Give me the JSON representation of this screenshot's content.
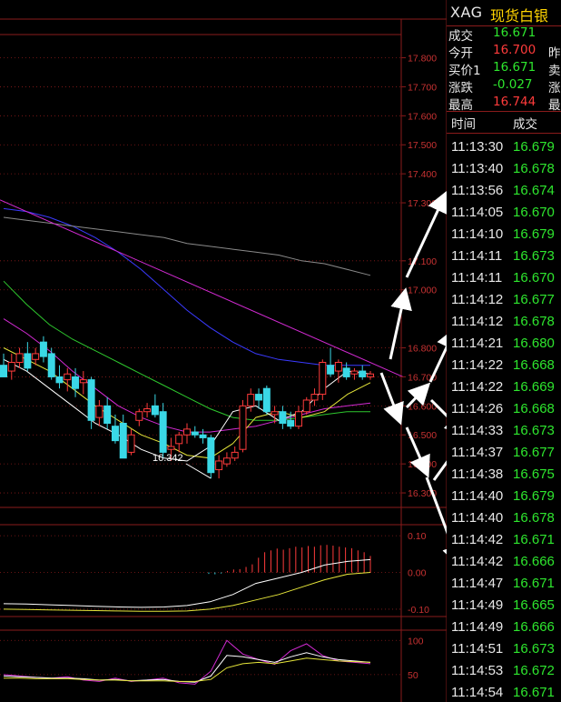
{
  "quote": {
    "symbol": "XAG",
    "name": "现货白银",
    "rows": [
      {
        "label": "成交",
        "value": "16.671",
        "color": "#2ee62e",
        "label2": ""
      },
      {
        "label": "今开",
        "value": "16.700",
        "color": "#ff3b3b",
        "label2": "昨"
      },
      {
        "label": "买价1",
        "value": "16.671",
        "color": "#2ee62e",
        "label2": "卖"
      },
      {
        "label": "涨跌",
        "value": "-0.027",
        "color": "#2ee62e",
        "label2": "涨"
      },
      {
        "label": "最高",
        "value": "16.744",
        "color": "#ff3b3b",
        "label2": "最"
      }
    ]
  },
  "trades": {
    "col_time": "时间",
    "col_price": "成交",
    "rows": [
      {
        "time": "11:13:30",
        "price": "16.679"
      },
      {
        "time": "11:13:40",
        "price": "16.678"
      },
      {
        "time": "11:13:56",
        "price": "16.674"
      },
      {
        "time": "11:14:05",
        "price": "16.670"
      },
      {
        "time": "11:14:10",
        "price": "16.679"
      },
      {
        "time": "11:14:11",
        "price": "16.673"
      },
      {
        "time": "11:14:11",
        "price": "16.670"
      },
      {
        "time": "11:14:12",
        "price": "16.677"
      },
      {
        "time": "11:14:12",
        "price": "16.678"
      },
      {
        "time": "11:14:21",
        "price": "16.680"
      },
      {
        "time": "11:14:22",
        "price": "16.668"
      },
      {
        "time": "11:14:22",
        "price": "16.669"
      },
      {
        "time": "11:14:26",
        "price": "16.668"
      },
      {
        "time": "11:14:33",
        "price": "16.673"
      },
      {
        "time": "11:14:37",
        "price": "16.677"
      },
      {
        "time": "11:14:38",
        "price": "16.675"
      },
      {
        "time": "11:14:40",
        "price": "16.679"
      },
      {
        "time": "11:14:40",
        "price": "16.678"
      },
      {
        "time": "11:14:42",
        "price": "16.671"
      },
      {
        "time": "11:14:42",
        "price": "16.666"
      },
      {
        "time": "11:14:47",
        "price": "16.671"
      },
      {
        "time": "11:14:49",
        "price": "16.665"
      },
      {
        "time": "11:14:49",
        "price": "16.666"
      },
      {
        "time": "11:14:51",
        "price": "16.673"
      },
      {
        "time": "11:14:53",
        "price": "16.672"
      },
      {
        "time": "11:14:54",
        "price": "16.671"
      }
    ]
  },
  "chart_data": [
    {
      "type": "candlestick",
      "title": "",
      "ylim": [
        16.25,
        17.88
      ],
      "y_ticks": [
        "17.800",
        "17.700",
        "17.600",
        "17.500",
        "17.400",
        "17.300",
        "17.100",
        "17.000",
        "16.800",
        "16.700",
        "16.600",
        "16.500",
        "16.400",
        "16.300"
      ],
      "annotations": [
        "16.342"
      ],
      "candles": [
        {
          "o": 16.74,
          "h": 16.78,
          "l": 16.7,
          "c": 16.7
        },
        {
          "o": 16.72,
          "h": 16.78,
          "l": 16.69,
          "c": 16.75
        },
        {
          "o": 16.75,
          "h": 16.8,
          "l": 16.73,
          "c": 16.78
        },
        {
          "o": 16.78,
          "h": 16.82,
          "l": 16.72,
          "c": 16.73
        },
        {
          "o": 16.76,
          "h": 16.8,
          "l": 16.74,
          "c": 16.78
        },
        {
          "o": 16.82,
          "h": 16.84,
          "l": 16.75,
          "c": 16.77
        },
        {
          "o": 16.78,
          "h": 16.8,
          "l": 16.69,
          "c": 16.7
        },
        {
          "o": 16.7,
          "h": 16.74,
          "l": 16.66,
          "c": 16.68
        },
        {
          "o": 16.69,
          "h": 16.73,
          "l": 16.65,
          "c": 16.71
        },
        {
          "o": 16.7,
          "h": 16.73,
          "l": 16.63,
          "c": 16.66
        },
        {
          "o": 16.68,
          "h": 16.72,
          "l": 16.64,
          "c": 16.69
        },
        {
          "o": 16.69,
          "h": 16.7,
          "l": 16.52,
          "c": 16.55
        },
        {
          "o": 16.56,
          "h": 16.62,
          "l": 16.53,
          "c": 16.6
        },
        {
          "o": 16.6,
          "h": 16.63,
          "l": 16.52,
          "c": 16.54
        },
        {
          "o": 16.53,
          "h": 16.57,
          "l": 16.47,
          "c": 16.48
        },
        {
          "o": 16.54,
          "h": 16.57,
          "l": 16.42,
          "c": 16.42
        },
        {
          "o": 16.44,
          "h": 16.52,
          "l": 16.43,
          "c": 16.5
        },
        {
          "o": 16.55,
          "h": 16.59,
          "l": 16.53,
          "c": 16.58
        },
        {
          "o": 16.58,
          "h": 16.61,
          "l": 16.56,
          "c": 16.59
        },
        {
          "o": 16.6,
          "h": 16.64,
          "l": 16.56,
          "c": 16.57
        },
        {
          "o": 16.58,
          "h": 16.61,
          "l": 16.42,
          "c": 16.44
        },
        {
          "o": 16.45,
          "h": 16.49,
          "l": 16.41,
          "c": 16.46
        },
        {
          "o": 16.47,
          "h": 16.51,
          "l": 16.44,
          "c": 16.5
        },
        {
          "o": 16.5,
          "h": 16.54,
          "l": 16.47,
          "c": 16.52
        },
        {
          "o": 16.51,
          "h": 16.53,
          "l": 16.49,
          "c": 16.5
        },
        {
          "o": 16.5,
          "h": 16.52,
          "l": 16.47,
          "c": 16.49
        },
        {
          "o": 16.49,
          "h": 16.5,
          "l": 16.35,
          "c": 16.37
        },
        {
          "o": 16.38,
          "h": 16.43,
          "l": 16.35,
          "c": 16.41
        },
        {
          "o": 16.4,
          "h": 16.44,
          "l": 16.39,
          "c": 16.42
        },
        {
          "o": 16.42,
          "h": 16.46,
          "l": 16.41,
          "c": 16.44
        },
        {
          "o": 16.45,
          "h": 16.62,
          "l": 16.44,
          "c": 16.6
        },
        {
          "o": 16.6,
          "h": 16.66,
          "l": 16.58,
          "c": 16.64
        },
        {
          "o": 16.64,
          "h": 16.66,
          "l": 16.59,
          "c": 16.62
        },
        {
          "o": 16.66,
          "h": 16.67,
          "l": 16.57,
          "c": 16.58
        },
        {
          "o": 16.57,
          "h": 16.6,
          "l": 16.54,
          "c": 16.58
        },
        {
          "o": 16.58,
          "h": 16.6,
          "l": 16.52,
          "c": 16.54
        },
        {
          "o": 16.55,
          "h": 16.58,
          "l": 16.52,
          "c": 16.53
        },
        {
          "o": 16.53,
          "h": 16.6,
          "l": 16.52,
          "c": 16.58
        },
        {
          "o": 16.58,
          "h": 16.63,
          "l": 16.57,
          "c": 16.62
        },
        {
          "o": 16.62,
          "h": 16.66,
          "l": 16.6,
          "c": 16.64
        },
        {
          "o": 16.64,
          "h": 16.76,
          "l": 16.62,
          "c": 16.75
        },
        {
          "o": 16.74,
          "h": 16.8,
          "l": 16.7,
          "c": 16.71
        },
        {
          "o": 16.72,
          "h": 16.76,
          "l": 16.68,
          "c": 16.75
        },
        {
          "o": 16.73,
          "h": 16.75,
          "l": 16.69,
          "c": 16.7
        },
        {
          "o": 16.71,
          "h": 16.73,
          "l": 16.69,
          "c": 16.72
        },
        {
          "o": 16.72,
          "h": 16.74,
          "l": 16.69,
          "c": 16.7
        },
        {
          "o": 16.7,
          "h": 16.72,
          "l": 16.69,
          "c": 16.71
        }
      ],
      "moving_averages": [
        {
          "color": "#3a3aff",
          "values": [
            17.28,
            17.27,
            17.25,
            17.22,
            17.18,
            17.13,
            17.07,
            17.0,
            16.93,
            16.87,
            16.82,
            16.78,
            16.76,
            16.75,
            16.74,
            16.74,
            16.74
          ]
        },
        {
          "color": "#d22ad2",
          "values": [
            16.9,
            16.85,
            16.79,
            16.72,
            16.66,
            16.6,
            16.56,
            16.53,
            16.51,
            16.51,
            16.52,
            16.53,
            16.55,
            16.57,
            16.59,
            16.6,
            16.61
          ]
        },
        {
          "color": "#2ec82e",
          "values": [
            17.03,
            16.95,
            16.88,
            16.83,
            16.79,
            16.75,
            16.71,
            16.67,
            16.63,
            16.59,
            16.56,
            16.55,
            16.55,
            16.56,
            16.57,
            16.58,
            16.58
          ]
        },
        {
          "color": "#8a8a8a",
          "values": [
            17.25,
            17.24,
            17.23,
            17.22,
            17.21,
            17.2,
            17.19,
            17.18,
            17.16,
            17.15,
            17.14,
            17.13,
            17.12,
            17.1,
            17.09,
            17.07,
            17.05
          ]
        },
        {
          "color": "#e6e63a",
          "values": [
            16.8,
            16.76,
            16.72,
            16.66,
            16.6,
            16.55,
            16.5,
            16.47,
            16.43,
            16.42,
            16.47,
            16.56,
            16.58,
            16.56,
            16.58,
            16.64,
            16.68
          ]
        },
        {
          "color": "#ffffff",
          "values": [
            16.76,
            16.72,
            16.66,
            16.6,
            16.54,
            16.5,
            16.45,
            16.42,
            16.41,
            16.46,
            16.58,
            16.6,
            16.55,
            16.58,
            16.66,
            16.72,
            16.71
          ]
        }
      ],
      "trendline": {
        "color": "#d22ad2",
        "from": 17.31,
        "to": 16.7
      }
    },
    {
      "type": "bar",
      "title": "",
      "ylim": [
        -0.12,
        0.13
      ],
      "y_ticks": [
        "0.10",
        "0.00",
        "-0.10"
      ],
      "values": [
        0.0,
        0.0,
        0.0,
        0.0,
        0.0,
        0.0,
        0.0,
        0.0,
        0.0,
        0.0,
        0.0,
        0.0,
        0.0,
        0.0,
        0.0,
        0.0,
        0.0,
        0.0,
        0.0,
        0.0,
        0.0,
        0.0,
        0.0,
        0.0,
        0.0,
        0.0,
        0.0,
        0.0,
        0.0,
        0.0,
        0.0,
        0.0,
        0.0,
        -0.004,
        -0.005,
        -0.003,
        0.004,
        0.008,
        0.009,
        0.015,
        0.022,
        0.04,
        0.055,
        0.06,
        0.065,
        0.062,
        0.066,
        0.07,
        0.068,
        0.072,
        0.07,
        0.074,
        0.075,
        0.073,
        0.07,
        0.068,
        0.066,
        0.06,
        0.055,
        0.045
      ],
      "series": [
        {
          "color": "#ffffff",
          "values": [
            -0.085,
            -0.086,
            -0.088,
            -0.09,
            -0.092,
            -0.094,
            -0.095,
            -0.094,
            -0.09,
            -0.08,
            -0.06,
            -0.03,
            -0.015,
            0.0,
            0.02,
            0.03,
            0.035
          ]
        },
        {
          "color": "#e6e63a",
          "values": [
            -0.1,
            -0.101,
            -0.102,
            -0.103,
            -0.104,
            -0.105,
            -0.106,
            -0.106,
            -0.105,
            -0.1,
            -0.09,
            -0.075,
            -0.06,
            -0.04,
            -0.02,
            -0.005,
            0.0
          ]
        }
      ]
    },
    {
      "type": "line",
      "title": "",
      "ylim": [
        10,
        115
      ],
      "y_ticks": [
        "100",
        "50"
      ],
      "series": [
        {
          "color": "#d22ad2",
          "values": [
            50,
            48,
            46,
            45,
            47,
            42,
            40,
            45,
            40,
            42,
            45,
            38,
            36,
            55,
            100,
            80,
            72,
            65,
            85,
            95,
            78,
            70,
            68,
            66
          ]
        },
        {
          "color": "#ffffff",
          "values": [
            48,
            47,
            46,
            45,
            45,
            44,
            42,
            43,
            41,
            42,
            43,
            40,
            39,
            48,
            78,
            76,
            72,
            68,
            76,
            82,
            76,
            72,
            70,
            68
          ]
        },
        {
          "color": "#e6e63a",
          "values": [
            45,
            45,
            44,
            44,
            44,
            43,
            42,
            42,
            41,
            41,
            41,
            40,
            40,
            43,
            60,
            66,
            68,
            66,
            70,
            74,
            72,
            70,
            69,
            68
          ]
        }
      ]
    }
  ]
}
